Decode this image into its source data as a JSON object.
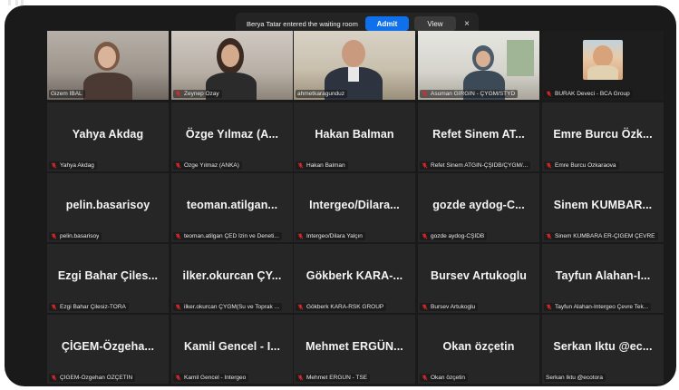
{
  "notification": {
    "message": "Berya Tatar entered the waiting room",
    "admit_label": "Admit",
    "view_label": "View",
    "close_glyph": "×"
  },
  "colors": {
    "background": "#1a1a1a",
    "tile": "#262626",
    "admit_button": "#0e71eb",
    "active_speaker_border": "#b6e34b",
    "muted_icon": "#e02828"
  },
  "video_tiles": [
    {
      "label": "Gizem İBAL",
      "muted": false
    },
    {
      "label": "Zeynep Ozay",
      "muted": true
    },
    {
      "label": "ahmetkaragunduz",
      "muted": false,
      "active_speaker": true
    },
    {
      "label": "Asuman GİRGİN - ÇYGM/STYD",
      "muted": true
    },
    {
      "label": "BURAK Deveci - BCA Group",
      "muted": true
    }
  ],
  "name_tiles": [
    {
      "display": "Yahya Akdag",
      "label": "Yahya Akdag",
      "muted": true
    },
    {
      "display": "Özge Yılmaz (A...",
      "label": "Özge Yılmaz (ANKA)",
      "muted": true
    },
    {
      "display": "Hakan Balman",
      "label": "Hakan Balman",
      "muted": true
    },
    {
      "display": "Refet Sinem AT...",
      "label": "Refet Sinem ATGIN-ÇŞİDB/ÇYGM/...",
      "muted": true
    },
    {
      "display": "Emre Burcu Özk...",
      "label": "Emre Burcu Özkaraova",
      "muted": true
    },
    {
      "display": "pelin.basarisoy",
      "label": "pelin.basarisoy",
      "muted": true
    },
    {
      "display": "teoman.atilgan...",
      "label": "teoman.atilgan ÇED İzin ve Deneti...",
      "muted": true
    },
    {
      "display": "Intergeo/Dilara...",
      "label": "Intergeo/Dilara Yalçın",
      "muted": true
    },
    {
      "display": "gozde aydog-C...",
      "label": "gozde aydog-CŞİDB",
      "muted": true
    },
    {
      "display": "Sinem KUMBAR...",
      "label": "Sinem KUMBARA ER-ÇİGEM ÇEVRE",
      "muted": true
    },
    {
      "display": "Ezgi Bahar Çiles...",
      "label": "Ezgi Bahar Çilesiz-TORA",
      "muted": true
    },
    {
      "display": "ilker.okurcan ÇY...",
      "label": "ilker.okurcan ÇYGM(Su ve Toprak ...",
      "muted": true
    },
    {
      "display": "Gökberk KARA-...",
      "label": "Gökberk KARA-RSK GROUP",
      "muted": true
    },
    {
      "display": "Bursev Artukoglu",
      "label": "Bursev Artukoglu",
      "muted": true
    },
    {
      "display": "Tayfun Alahan-I...",
      "label": "Tayfun Alahan-Intergeo Çevre Tek...",
      "muted": true
    },
    {
      "display": "ÇİGEM-Özgeha...",
      "label": "ÇİGEM-Özgehan ÖZÇETİN",
      "muted": true
    },
    {
      "display": "Kamil Gencel - I...",
      "label": "Kamil Gencel - Intergeo",
      "muted": true
    },
    {
      "display": "Mehmet ERGÜN...",
      "label": "Mehmet ERGÜN - TSE",
      "muted": true
    },
    {
      "display": "Okan özçetin",
      "label": "Okan özçetin",
      "muted": true
    },
    {
      "display": "Serkan Iktu @ec...",
      "label": "Serkan Iktu @ecotora",
      "muted": false
    }
  ]
}
